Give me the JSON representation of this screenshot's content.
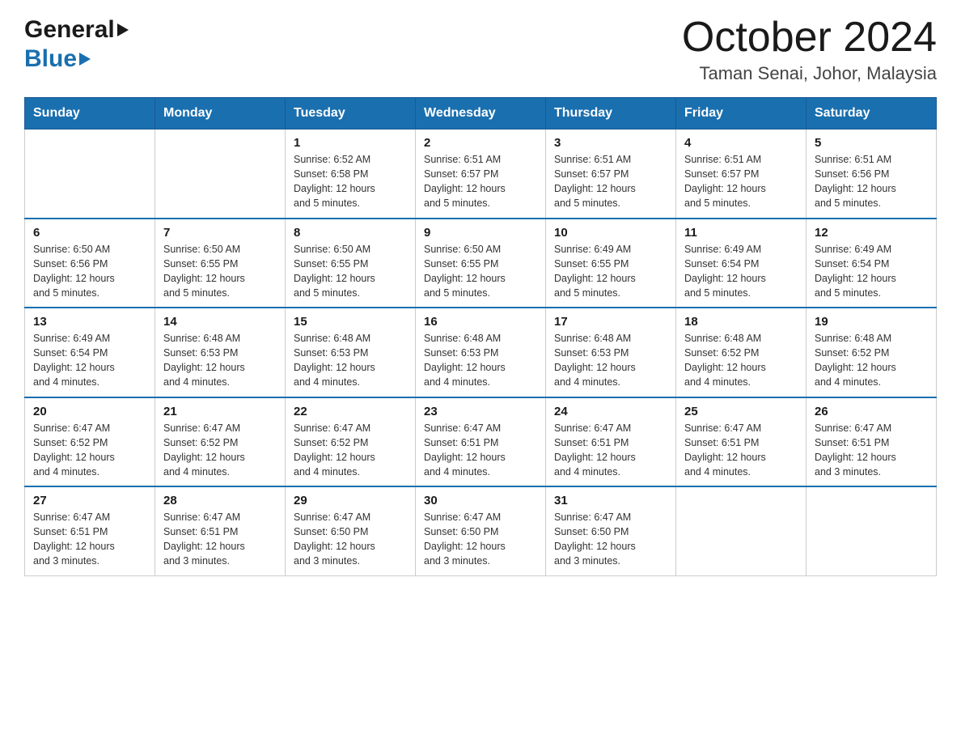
{
  "header": {
    "logo_general": "General",
    "logo_blue": "Blue",
    "month_title": "October 2024",
    "location": "Taman Senai, Johor, Malaysia"
  },
  "calendar": {
    "days_of_week": [
      "Sunday",
      "Monday",
      "Tuesday",
      "Wednesday",
      "Thursday",
      "Friday",
      "Saturday"
    ],
    "weeks": [
      [
        {
          "day": "",
          "info": ""
        },
        {
          "day": "",
          "info": ""
        },
        {
          "day": "1",
          "info": "Sunrise: 6:52 AM\nSunset: 6:58 PM\nDaylight: 12 hours\nand 5 minutes."
        },
        {
          "day": "2",
          "info": "Sunrise: 6:51 AM\nSunset: 6:57 PM\nDaylight: 12 hours\nand 5 minutes."
        },
        {
          "day": "3",
          "info": "Sunrise: 6:51 AM\nSunset: 6:57 PM\nDaylight: 12 hours\nand 5 minutes."
        },
        {
          "day": "4",
          "info": "Sunrise: 6:51 AM\nSunset: 6:57 PM\nDaylight: 12 hours\nand 5 minutes."
        },
        {
          "day": "5",
          "info": "Sunrise: 6:51 AM\nSunset: 6:56 PM\nDaylight: 12 hours\nand 5 minutes."
        }
      ],
      [
        {
          "day": "6",
          "info": "Sunrise: 6:50 AM\nSunset: 6:56 PM\nDaylight: 12 hours\nand 5 minutes."
        },
        {
          "day": "7",
          "info": "Sunrise: 6:50 AM\nSunset: 6:55 PM\nDaylight: 12 hours\nand 5 minutes."
        },
        {
          "day": "8",
          "info": "Sunrise: 6:50 AM\nSunset: 6:55 PM\nDaylight: 12 hours\nand 5 minutes."
        },
        {
          "day": "9",
          "info": "Sunrise: 6:50 AM\nSunset: 6:55 PM\nDaylight: 12 hours\nand 5 minutes."
        },
        {
          "day": "10",
          "info": "Sunrise: 6:49 AM\nSunset: 6:55 PM\nDaylight: 12 hours\nand 5 minutes."
        },
        {
          "day": "11",
          "info": "Sunrise: 6:49 AM\nSunset: 6:54 PM\nDaylight: 12 hours\nand 5 minutes."
        },
        {
          "day": "12",
          "info": "Sunrise: 6:49 AM\nSunset: 6:54 PM\nDaylight: 12 hours\nand 5 minutes."
        }
      ],
      [
        {
          "day": "13",
          "info": "Sunrise: 6:49 AM\nSunset: 6:54 PM\nDaylight: 12 hours\nand 4 minutes."
        },
        {
          "day": "14",
          "info": "Sunrise: 6:48 AM\nSunset: 6:53 PM\nDaylight: 12 hours\nand 4 minutes."
        },
        {
          "day": "15",
          "info": "Sunrise: 6:48 AM\nSunset: 6:53 PM\nDaylight: 12 hours\nand 4 minutes."
        },
        {
          "day": "16",
          "info": "Sunrise: 6:48 AM\nSunset: 6:53 PM\nDaylight: 12 hours\nand 4 minutes."
        },
        {
          "day": "17",
          "info": "Sunrise: 6:48 AM\nSunset: 6:53 PM\nDaylight: 12 hours\nand 4 minutes."
        },
        {
          "day": "18",
          "info": "Sunrise: 6:48 AM\nSunset: 6:52 PM\nDaylight: 12 hours\nand 4 minutes."
        },
        {
          "day": "19",
          "info": "Sunrise: 6:48 AM\nSunset: 6:52 PM\nDaylight: 12 hours\nand 4 minutes."
        }
      ],
      [
        {
          "day": "20",
          "info": "Sunrise: 6:47 AM\nSunset: 6:52 PM\nDaylight: 12 hours\nand 4 minutes."
        },
        {
          "day": "21",
          "info": "Sunrise: 6:47 AM\nSunset: 6:52 PM\nDaylight: 12 hours\nand 4 minutes."
        },
        {
          "day": "22",
          "info": "Sunrise: 6:47 AM\nSunset: 6:52 PM\nDaylight: 12 hours\nand 4 minutes."
        },
        {
          "day": "23",
          "info": "Sunrise: 6:47 AM\nSunset: 6:51 PM\nDaylight: 12 hours\nand 4 minutes."
        },
        {
          "day": "24",
          "info": "Sunrise: 6:47 AM\nSunset: 6:51 PM\nDaylight: 12 hours\nand 4 minutes."
        },
        {
          "day": "25",
          "info": "Sunrise: 6:47 AM\nSunset: 6:51 PM\nDaylight: 12 hours\nand 4 minutes."
        },
        {
          "day": "26",
          "info": "Sunrise: 6:47 AM\nSunset: 6:51 PM\nDaylight: 12 hours\nand 3 minutes."
        }
      ],
      [
        {
          "day": "27",
          "info": "Sunrise: 6:47 AM\nSunset: 6:51 PM\nDaylight: 12 hours\nand 3 minutes."
        },
        {
          "day": "28",
          "info": "Sunrise: 6:47 AM\nSunset: 6:51 PM\nDaylight: 12 hours\nand 3 minutes."
        },
        {
          "day": "29",
          "info": "Sunrise: 6:47 AM\nSunset: 6:50 PM\nDaylight: 12 hours\nand 3 minutes."
        },
        {
          "day": "30",
          "info": "Sunrise: 6:47 AM\nSunset: 6:50 PM\nDaylight: 12 hours\nand 3 minutes."
        },
        {
          "day": "31",
          "info": "Sunrise: 6:47 AM\nSunset: 6:50 PM\nDaylight: 12 hours\nand 3 minutes."
        },
        {
          "day": "",
          "info": ""
        },
        {
          "day": "",
          "info": ""
        }
      ]
    ]
  }
}
